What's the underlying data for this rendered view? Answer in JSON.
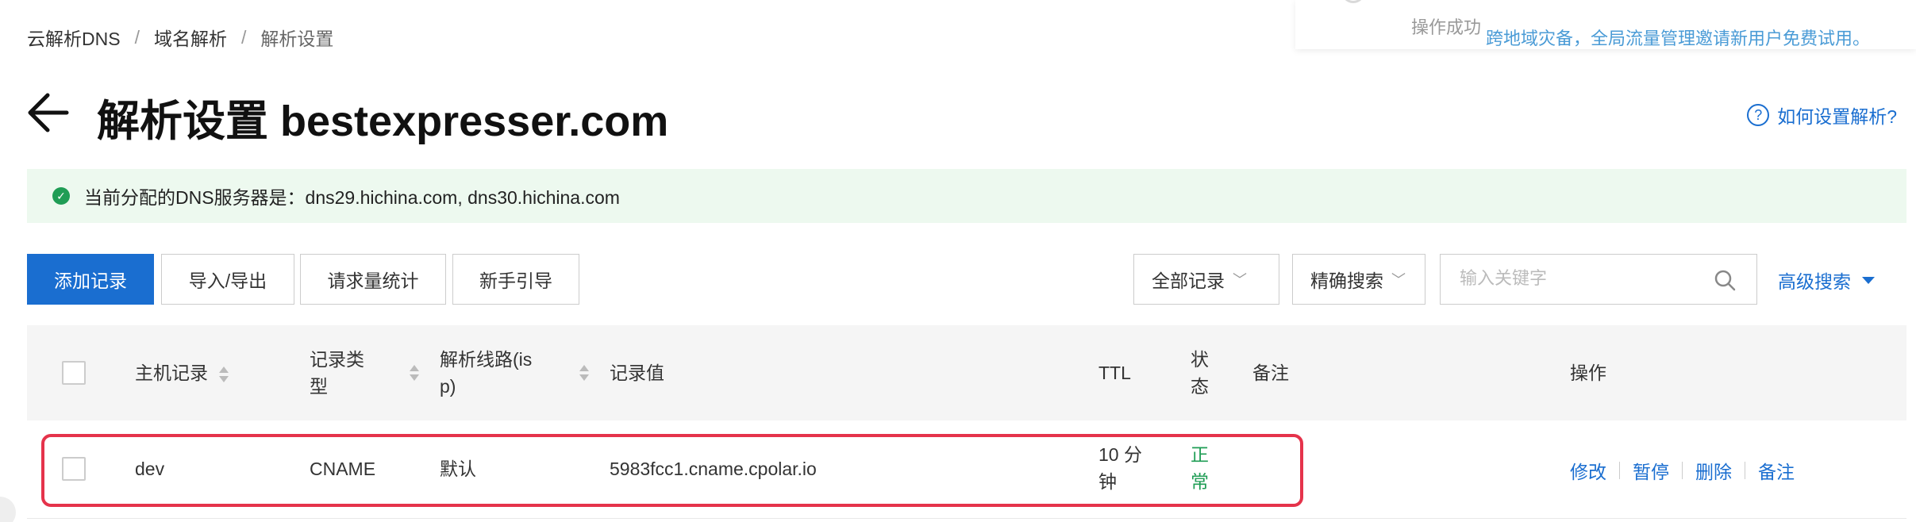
{
  "toast": {
    "message": "操作成功",
    "promo": "跨地域灾备，全局流量管理邀请新用户免费试用。"
  },
  "breadcrumb": {
    "items": [
      "云解析DNS",
      "域名解析",
      "解析设置"
    ],
    "separator": "/"
  },
  "header": {
    "title": "解析设置 bestexpresser.com",
    "help_label": "如何设置解析?",
    "help_icon": "?"
  },
  "dns_info": {
    "text": "当前分配的DNS服务器是：dns29.hichina.com, dns30.hichina.com",
    "icon": "✓"
  },
  "toolbar": {
    "add_label": "添加记录",
    "import_export_label": "导入/导出",
    "stats_label": "请求量统计",
    "guide_label": "新手引导",
    "filter_value": "全部记录",
    "match_value": "精确搜索",
    "search_placeholder": "输入关键字",
    "advanced_label": "高级搜索",
    "chevron": "﹀"
  },
  "table": {
    "headers": {
      "host": "主机记录",
      "type_line1": "记录类",
      "type_line2": "型",
      "line_line1": "解析线路(is",
      "line_line2": "p)",
      "value": "记录值",
      "ttl": "TTL",
      "status_line1": "状",
      "status_line2": "态",
      "remark": "备注",
      "ops": "操作"
    },
    "rows": [
      {
        "host": "dev",
        "type": "CNAME",
        "line": "默认",
        "value": "5983fcc1.cname.cpolar.io",
        "ttl_line1": "10 分",
        "ttl_line2": "钟",
        "status_line1": "正",
        "status_line2": "常",
        "remark": "",
        "actions": [
          "修改",
          "暂停",
          "删除",
          "备注"
        ]
      }
    ]
  },
  "colors": {
    "primary": "#1a6ed0",
    "success": "#1f9d55",
    "highlight": "#e5334b",
    "info_bg": "#edf9ef"
  }
}
